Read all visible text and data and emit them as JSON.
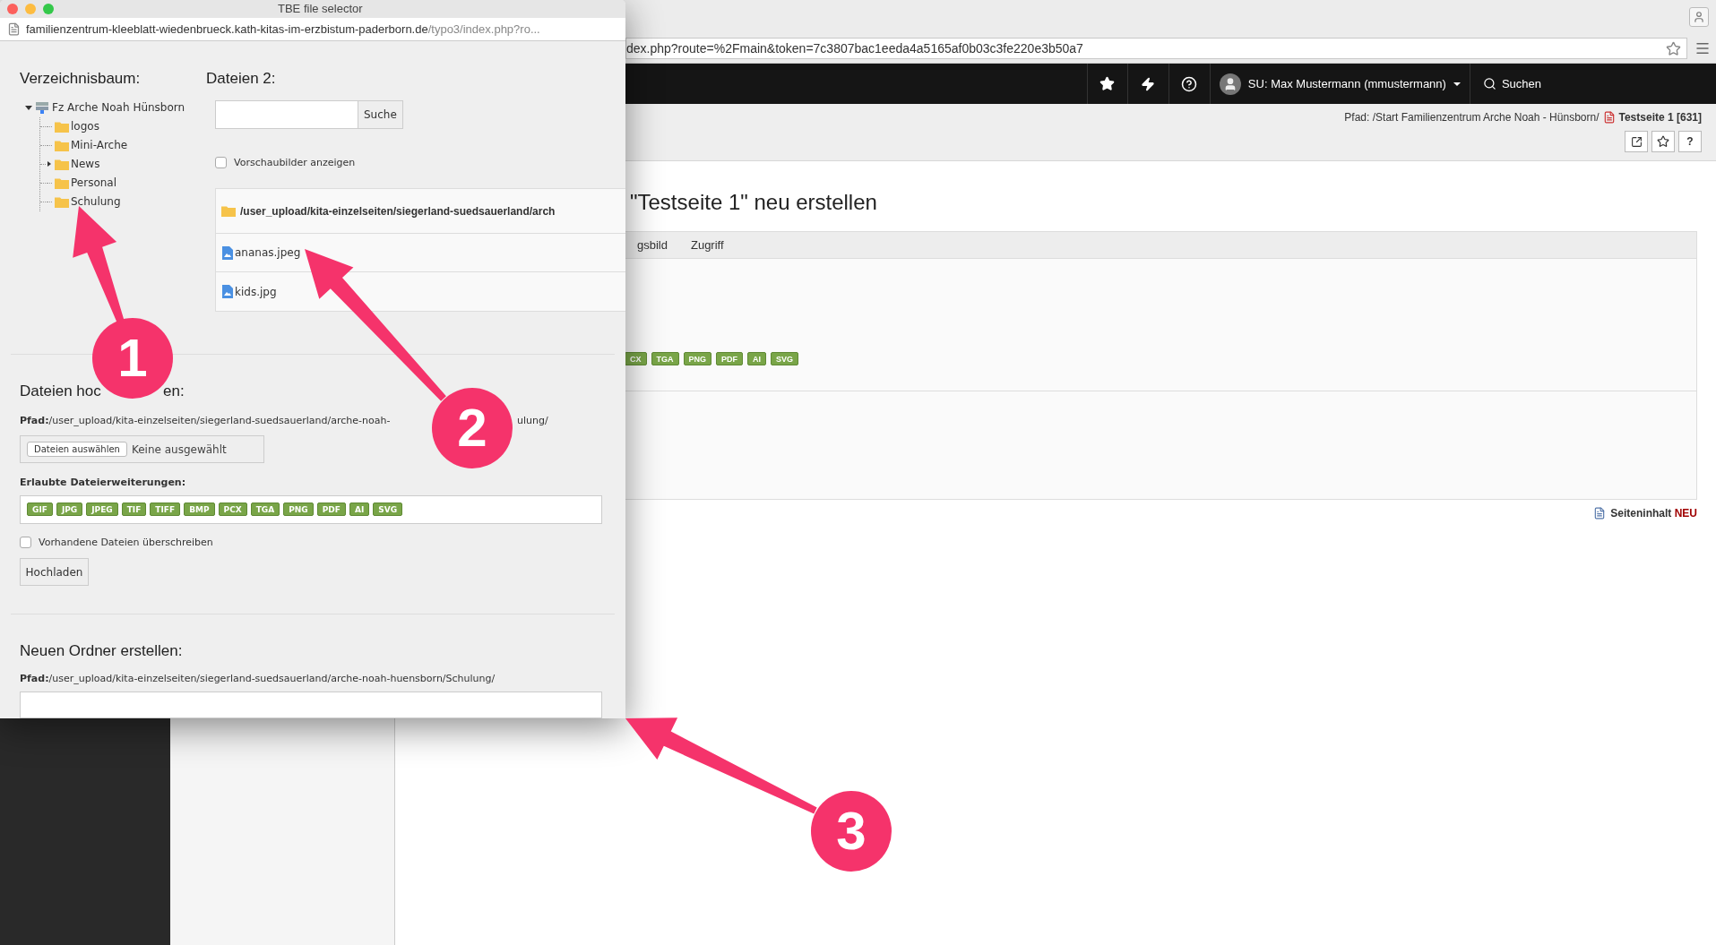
{
  "browser": {
    "url": "dex.php?route=%2Fmain&token=7c3807bac1eeda4a5165af0b03c3fe220e3b50a7"
  },
  "topbar": {
    "user": "SU: Max Mustermann (mmustermann)",
    "search": "Suchen"
  },
  "docheader": {
    "path": "Pfad: /Start Familienzentrum Arche Noah - Hünsborn/",
    "page": "Testseite 1 [631]",
    "help": "?"
  },
  "content": {
    "heading": "\"Testseite 1\" neu erstellen",
    "tabs": [
      {
        "label": "gsbild",
        "selected": false
      },
      {
        "label": "Zugriff",
        "selected": false
      }
    ],
    "extensions": [
      "CX",
      "TGA",
      "PNG",
      "PDF",
      "AI",
      "SVG"
    ],
    "new_content": {
      "label": "Seiteninhalt",
      "badge": "NEU"
    }
  },
  "popup": {
    "title": "TBE file selector",
    "url_host": "familienzentrum-kleeblatt-wiedenbrueck.kath-kitas-im-erzbistum-paderborn.de",
    "url_path": "/typo3/index.php?ro...",
    "tree": {
      "title": "Verzeichnisbaum:",
      "root": {
        "label": "Fz Arche Noah Hünsborn",
        "expanded": true,
        "children": [
          {
            "label": "logos",
            "expandable": false
          },
          {
            "label": "Mini-Arche",
            "expandable": false
          },
          {
            "label": "News",
            "expandable": true
          },
          {
            "label": "Personal",
            "expandable": false
          },
          {
            "label": "Schulung",
            "expandable": false
          }
        ]
      }
    },
    "files": {
      "title": "Dateien 2:",
      "search_button": "Suche",
      "thumbnails": {
        "label": "Vorschaubilder anzeigen",
        "checked": false
      },
      "folder_path": "/user_upload/kita-einzelseiten/siegerland-suedsauerland/arch",
      "items": [
        "ananas.jpeg",
        "kids.jpg"
      ]
    },
    "upload": {
      "title_parts": [
        "Dateien hoc",
        "en:"
      ],
      "path_parts": [
        "**Pfad:**/user_upload/kita-einzelseiten/siegerland-suedsauerland/arche-noah-",
        "ulung/"
      ],
      "choose_button": "Dateien auswählen",
      "no_file": "Keine ausgewählt",
      "extensions_label": "Erlaubte Dateierweiterungen:",
      "extensions": [
        "GIF",
        "JPG",
        "JPEG",
        "TIF",
        "TIFF",
        "BMP",
        "PCX",
        "TGA",
        "PNG",
        "PDF",
        "AI",
        "SVG"
      ],
      "overwrite": {
        "label": "Vorhandene Dateien überschreiben",
        "checked": false
      },
      "submit": "Hochladen"
    },
    "new_folder": {
      "title": "Neuen Ordner erstellen:",
      "path": "**Pfad:**/user_upload/kita-einzelseiten/siegerland-suedsauerland/arche-noah-huensborn/Schulung/"
    }
  },
  "callouts": [
    {
      "number": "1"
    },
    {
      "number": "2"
    },
    {
      "number": "3"
    }
  ]
}
